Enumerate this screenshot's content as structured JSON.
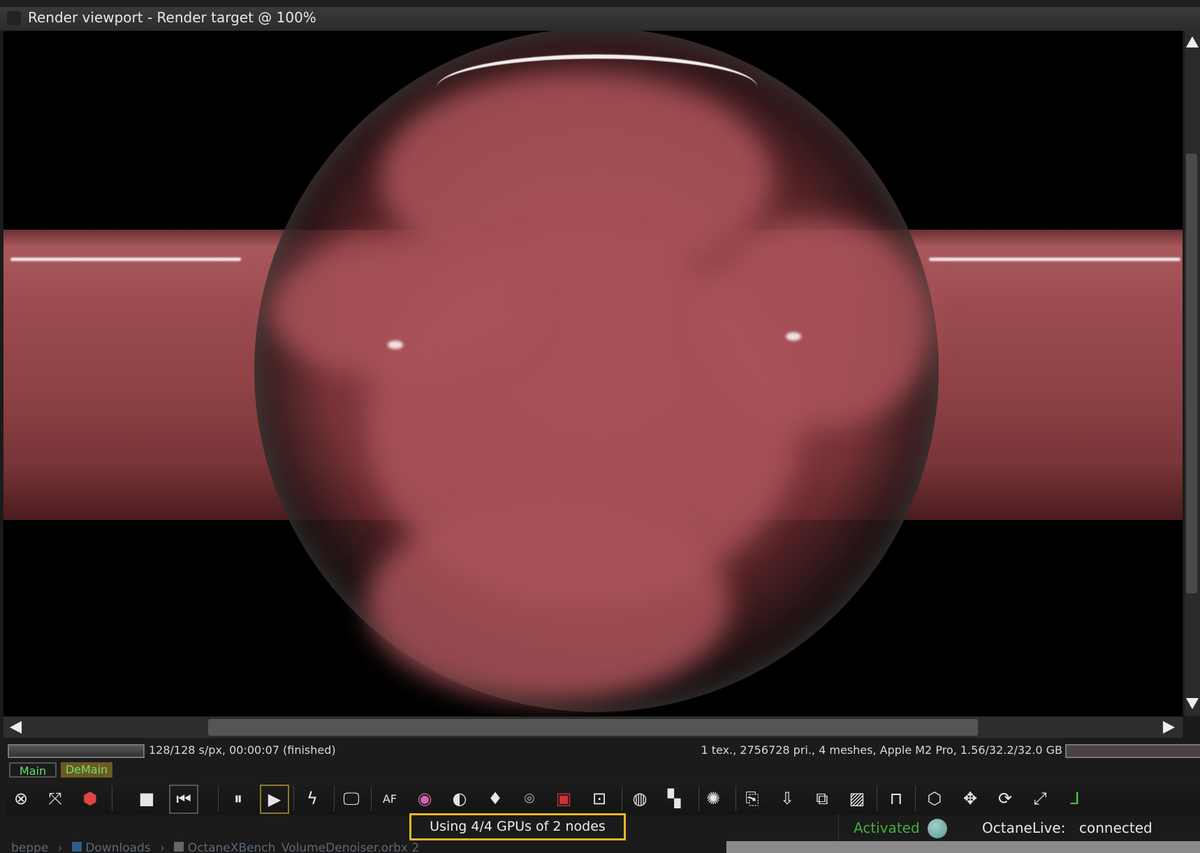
{
  "window": {
    "title": "Render viewport - Render target @ 100%"
  },
  "render": {
    "left_status": "128/128 s/px, 00:00:07 (finished)",
    "right_status": "1 tex., 2756728 pri., 4 meshes, Apple M2 Pro, 1.56/32.2/32.0 GB",
    "progress": 1.0
  },
  "render_targets": [
    {
      "label": "Main",
      "active": false
    },
    {
      "label": "DeMain",
      "active": true
    }
  ],
  "toolbar": {
    "icons": [
      {
        "name": "recenter-view-icon",
        "glyph": "⊗"
      },
      {
        "name": "fit-view-icon",
        "glyph": "⤧"
      },
      {
        "name": "camera-target-cube-icon",
        "glyph": "⬢"
      },
      {
        "name": "stop-render-icon",
        "glyph": "■"
      },
      {
        "name": "restart-render-icon",
        "glyph": "⏮"
      },
      {
        "name": "pause-render-icon",
        "glyph": "⏸"
      },
      {
        "name": "start-render-icon",
        "glyph": "▶"
      },
      {
        "name": "real-time-render-icon",
        "glyph": "ϟ"
      },
      {
        "name": "viewport-resolution-icon",
        "glyph": "🖵"
      },
      {
        "name": "autofocus-picker-icon",
        "glyph": "AF"
      },
      {
        "name": "white-balance-picker-icon",
        "glyph": "◉"
      },
      {
        "name": "material-picker-icon",
        "glyph": "◐"
      },
      {
        "name": "object-picker-icon",
        "glyph": "♦"
      },
      {
        "name": "camera-target-picker-icon",
        "glyph": "⌾"
      },
      {
        "name": "render-region-picker-icon",
        "glyph": "▣"
      },
      {
        "name": "film-region-picker-icon",
        "glyph": "⊡"
      },
      {
        "name": "clay-mode-icon",
        "glyph": "◍"
      },
      {
        "name": "subsampling-icon",
        "glyph": "▚"
      },
      {
        "name": "priority-icon",
        "glyph": "✺"
      },
      {
        "name": "copy-clipboard-icon",
        "glyph": "⎘"
      },
      {
        "name": "save-render-icon",
        "glyph": "⇩"
      },
      {
        "name": "save-passes-icon",
        "glyph": "⧉"
      },
      {
        "name": "background-image-icon",
        "glyph": "▨"
      },
      {
        "name": "lock-viewport-icon",
        "glyph": "⊓"
      },
      {
        "name": "viewport-mode-icon",
        "glyph": "⬡"
      },
      {
        "name": "move-gizmo-icon",
        "glyph": "✥"
      },
      {
        "name": "rotate-gizmo-icon",
        "glyph": "⟳"
      },
      {
        "name": "scale-gizmo-icon",
        "glyph": "⤢"
      },
      {
        "name": "world-axis-icon",
        "glyph": "⅃"
      }
    ]
  },
  "footer": {
    "gpu_status": "Using 4/4 GPUs of 2 nodes",
    "activation": "Activated",
    "octanelive_label": "OctaneLive:",
    "octanelive_status": "connected",
    "colors": {
      "highlight": "#e8b62a",
      "activated": "#3fae3f",
      "status_dot": "#6fa8a0"
    }
  },
  "breadcrumb": [
    "beppe",
    "Downloads",
    "OctaneXBench_VolumeDenoiser.orbx 2"
  ]
}
